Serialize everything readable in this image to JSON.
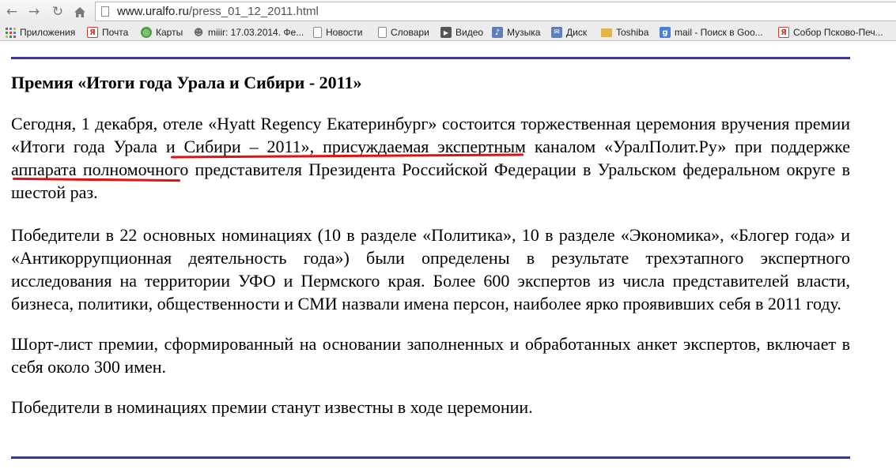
{
  "browser": {
    "url_host": "www.uralfo.ru",
    "url_path": "/press_01_12_2011.html",
    "bookmarks": [
      {
        "label": "Приложения",
        "icon": "apps-grid-icon",
        "color": "#4a7fd6"
      },
      {
        "label": "Почта",
        "icon": "yandex-mail-icon",
        "color": "#d23a2b"
      },
      {
        "label": "Карты",
        "icon": "maps-icon",
        "color": "#49a33d"
      },
      {
        "label": "miiir: 17.03.2014. Фе...",
        "icon": "user-icon",
        "color": "#6a6a6a"
      },
      {
        "label": "Новости",
        "icon": "page-icon",
        "color": "#8a8a8a"
      },
      {
        "label": "Словари",
        "icon": "page-icon",
        "color": "#8a8a8a"
      },
      {
        "label": "Видео",
        "icon": "play-icon",
        "color": "#555555"
      },
      {
        "label": "Музыка",
        "icon": "music-icon",
        "color": "#5f7fb8"
      },
      {
        "label": "Диск",
        "icon": "mail-icon",
        "color": "#5f7fb8"
      },
      {
        "label": "Toshiba",
        "icon": "folder-icon",
        "color": "#e0b64a"
      },
      {
        "label": "mail - Поиск в Goo...",
        "icon": "google-icon",
        "color": "#4a7fd6"
      },
      {
        "label": "Собор Псково-Печ...",
        "icon": "yandex-icon",
        "color": "#d23a2b"
      }
    ]
  },
  "article": {
    "title": "Премия «Итоги года Урала и Сибири - 2011»",
    "p1_a": "Сегодня, 1 декабря, отеле «Hyatt Regency Екатеринбург» состоится торжественная церемония вручения премии ",
    "p1_link1": "«Итоги года Урала и Сибири – 2011»",
    "p1_b": ", присуждаемая экспертным каналом ",
    "p1_link2": "«УралПолит.Ру»",
    "p1_c": " при поддержке аппарата полномочного представителя Президента Российской Федерации в Уральском федеральном округе в шестой раз.",
    "p2": "Победители в 22 основных номинациях (10 в разделе «Политика», 10 в разделе «Экономика», «Блогер года» и «Антикоррупционная деятельность года») были определены в результате трехэтапного экспертного исследования на территории УФО и Пермского края. Более 600 экспертов из числа представителей власти, бизнеса, политики, общественности и СМИ назвали имена персон, наиболее ярко проявивших себя в 2011 году.",
    "p3": "Шорт-лист премии, сформированный на основании заполненных и обработанных анкет экспертов, включает в себя около 300 имен.",
    "p4": "Победители в номинациях премии станут известны в ходе церемонии."
  },
  "colors": {
    "rule": "#3a3a8c",
    "annotation": "#e41010"
  }
}
